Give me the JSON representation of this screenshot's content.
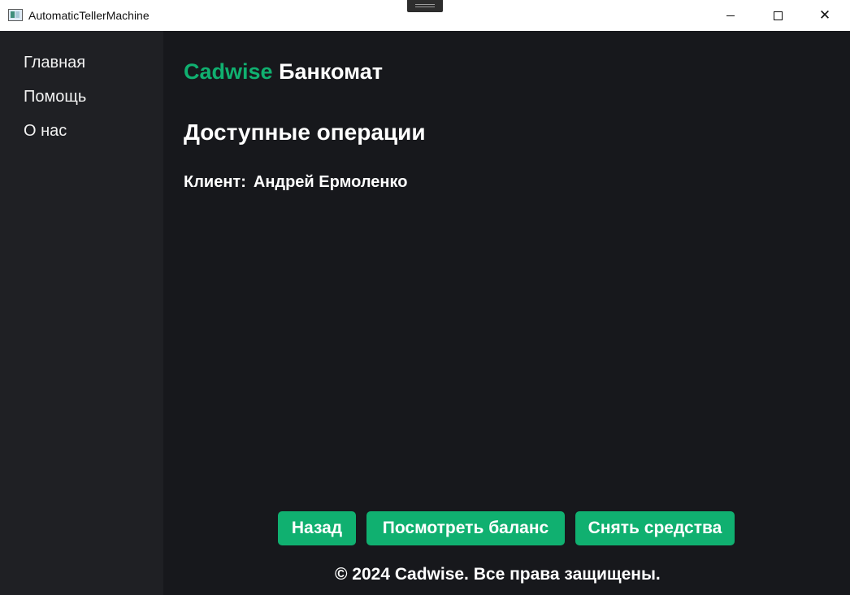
{
  "window": {
    "title": "AutomaticTellerMachine",
    "app_icon": "app-window-icon",
    "controls": {
      "minimize_icon": "minimize-icon",
      "maximize_icon": "maximize-icon",
      "close_icon": "close-icon",
      "close_glyph": "✕"
    }
  },
  "sidebar": {
    "items": [
      {
        "label": "Главная"
      },
      {
        "label": "Помощь"
      },
      {
        "label": "О нас"
      }
    ]
  },
  "main": {
    "brand": {
      "accent": "Cadwise",
      "rest": "Банкомат"
    },
    "section_title": "Доступные операции",
    "client": {
      "label": "Клиент:",
      "name": "Андрей Ермоленко"
    },
    "buttons": {
      "back": "Назад",
      "balance": "Посмотреть баланс",
      "withdraw": "Снять средства"
    },
    "footer": "© 2024 Cadwise. Все права защищены."
  },
  "colors": {
    "accent": "#10b070",
    "sidebar_bg": "#1f2024",
    "main_bg": "#17181c",
    "text": "#ffffff"
  }
}
